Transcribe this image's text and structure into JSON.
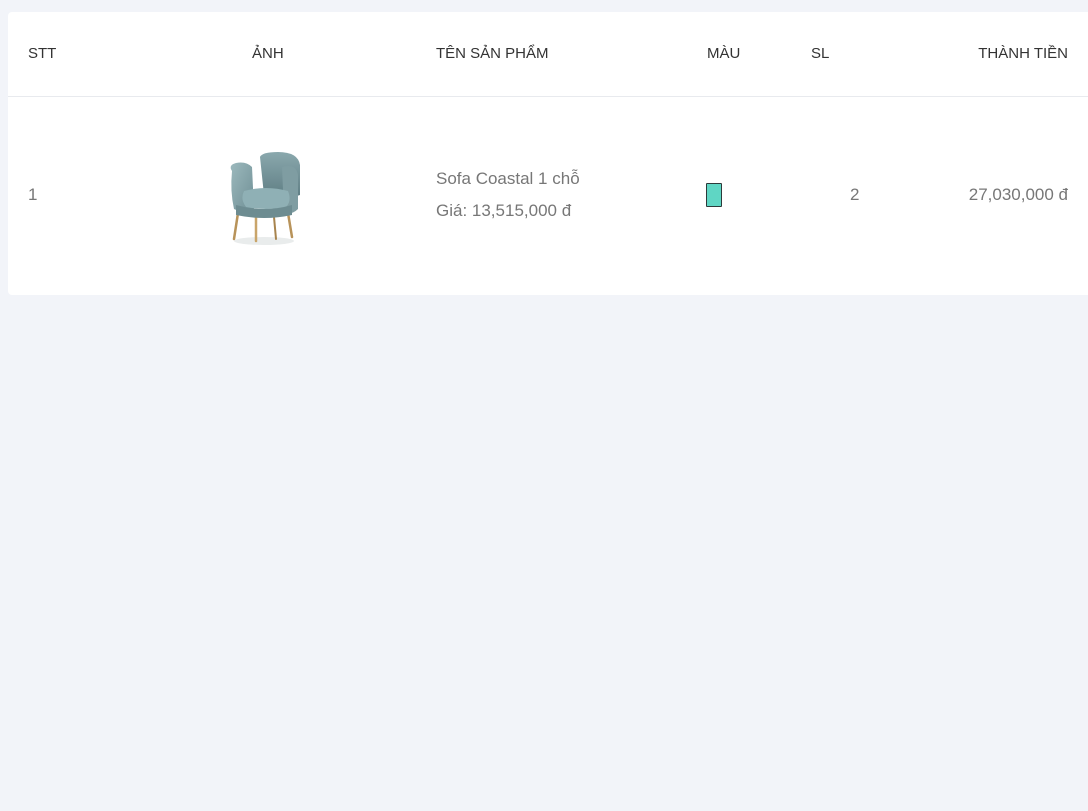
{
  "table": {
    "headers": {
      "stt": "STT",
      "image": "ẢNH",
      "product_name": "TÊN SẢN PHẨM",
      "color": "MÀU",
      "quantity": "SL",
      "total": "THÀNH TIỀN"
    },
    "rows": [
      {
        "stt": "1",
        "image_icon": "armchair-image",
        "name": "Sofa Coastal 1 chỗ",
        "price": "Giá: 13,515,000 đ",
        "color_hex": "#5fd6c4",
        "quantity": "2",
        "total": "27,030,000 đ"
      }
    ]
  }
}
